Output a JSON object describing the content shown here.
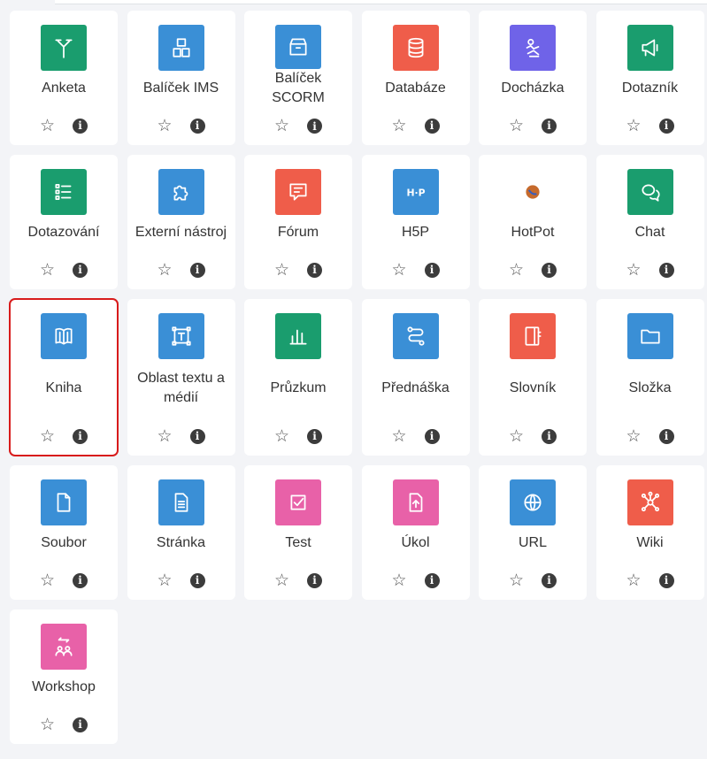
{
  "colors": {
    "green": "#1a9d6e",
    "blue": "#3a8fd6",
    "red": "#ef5d4a",
    "purple": "#6f63e8",
    "pink": "#e861a8",
    "selection": "#d81b1b"
  },
  "activities": [
    {
      "key": "anketa",
      "label": "Anketa",
      "icon": "choice-icon",
      "color": "#1a9d6e"
    },
    {
      "key": "balicek-ims",
      "label": "Balíček IMS",
      "icon": "package-icon",
      "color": "#3a8fd6"
    },
    {
      "key": "balicek-scorm",
      "label": "Balíček SCORM",
      "icon": "package-box-icon",
      "color": "#3a8fd6"
    },
    {
      "key": "databaze",
      "label": "Databáze",
      "icon": "database-icon",
      "color": "#ef5d4a"
    },
    {
      "key": "dochazka",
      "label": "Docházka",
      "icon": "attendance-icon",
      "color": "#6f63e8"
    },
    {
      "key": "dotaznik",
      "label": "Dotazník",
      "icon": "megaphone-icon",
      "color": "#1a9d6e"
    },
    {
      "key": "dotazovani",
      "label": "Dotazování",
      "icon": "list-icon",
      "color": "#1a9d6e"
    },
    {
      "key": "externi-nastroj",
      "label": "Externí nástroj",
      "icon": "puzzle-icon",
      "color": "#3a8fd6"
    },
    {
      "key": "forum",
      "label": "Fórum",
      "icon": "forum-icon",
      "color": "#ef5d4a"
    },
    {
      "key": "h5p",
      "label": "H5P",
      "icon": "h5p-icon",
      "color": "#3a8fd6"
    },
    {
      "key": "hotpot",
      "label": "HotPot",
      "icon": "hotpot-icon",
      "color": "#ffffff"
    },
    {
      "key": "chat",
      "label": "Chat",
      "icon": "chat-icon",
      "color": "#1a9d6e"
    },
    {
      "key": "kniha",
      "label": "Kniha",
      "icon": "book-icon",
      "color": "#3a8fd6",
      "selected": true
    },
    {
      "key": "oblast-textu",
      "label": "Oblast textu a médií",
      "icon": "text-area-icon",
      "color": "#3a8fd6"
    },
    {
      "key": "pruzkum",
      "label": "Průzkum",
      "icon": "bar-chart-icon",
      "color": "#1a9d6e"
    },
    {
      "key": "prednaska",
      "label": "Přednáška",
      "icon": "lesson-path-icon",
      "color": "#3a8fd6"
    },
    {
      "key": "slovnik",
      "label": "Slovník",
      "icon": "glossary-icon",
      "color": "#ef5d4a"
    },
    {
      "key": "slozka",
      "label": "Složka",
      "icon": "folder-icon",
      "color": "#3a8fd6"
    },
    {
      "key": "soubor",
      "label": "Soubor",
      "icon": "file-icon",
      "color": "#3a8fd6"
    },
    {
      "key": "stranka",
      "label": "Stránka",
      "icon": "page-icon",
      "color": "#3a8fd6"
    },
    {
      "key": "test",
      "label": "Test",
      "icon": "quiz-check-icon",
      "color": "#e861a8"
    },
    {
      "key": "ukol",
      "label": "Úkol",
      "icon": "assignment-upload-icon",
      "color": "#e861a8"
    },
    {
      "key": "url",
      "label": "URL",
      "icon": "globe-icon",
      "color": "#3a8fd6"
    },
    {
      "key": "wiki",
      "label": "Wiki",
      "icon": "wiki-network-icon",
      "color": "#ef5d4a"
    },
    {
      "key": "workshop",
      "label": "Workshop",
      "icon": "workshop-people-icon",
      "color": "#e861a8"
    }
  ]
}
